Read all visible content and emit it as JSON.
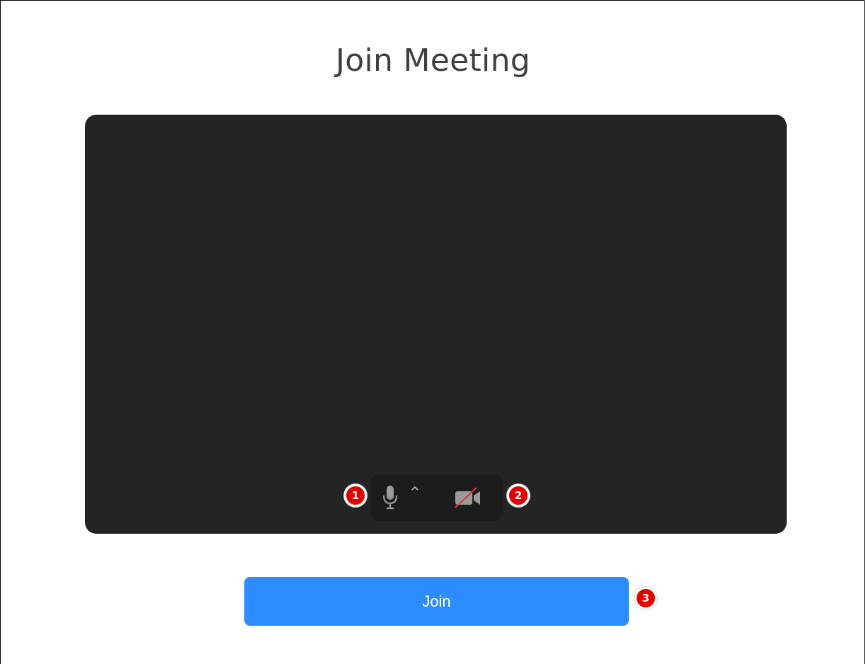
{
  "page": {
    "title": "Join Meeting"
  },
  "preview": {
    "mic_icon": "microphone-icon",
    "chevron_icon": "chevron-up-icon",
    "camera_icon": "video-camera-off-icon"
  },
  "join": {
    "label": "Join"
  },
  "annotations": [
    {
      "label": "1"
    },
    {
      "label": "2"
    },
    {
      "label": "3"
    }
  ],
  "colors": {
    "background": "#ffffff",
    "title_text": "#3f3f3f",
    "preview_bg": "#242424",
    "controls_bg": "#1c1c1c",
    "icon_gray": "#9a9a9a",
    "camera_slash": "#e0362b",
    "join_button": "#2d8cff",
    "badge_red": "#e20000"
  }
}
